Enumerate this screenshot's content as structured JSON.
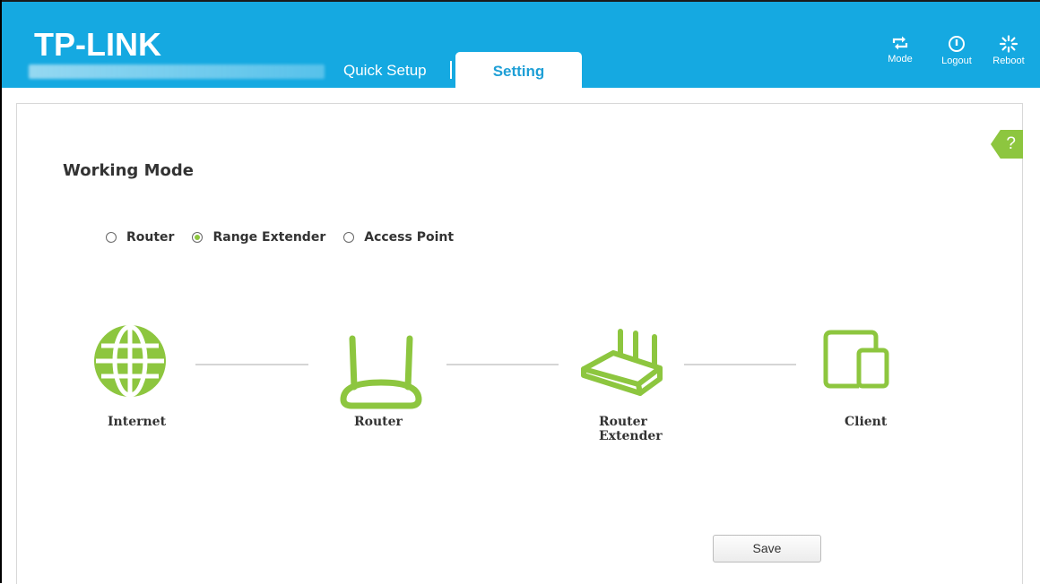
{
  "header": {
    "logo": "TP-LINK",
    "tabs": {
      "quick_setup": "Quick Setup",
      "setting": "Setting"
    },
    "buttons": {
      "mode": "Mode",
      "logout": "Logout",
      "reboot": "Reboot"
    }
  },
  "help": {
    "label": "?"
  },
  "main": {
    "title": "Working Mode",
    "modes": [
      {
        "label": "Router",
        "selected": false
      },
      {
        "label": "Range Extender",
        "selected": true
      },
      {
        "label": "Access Point",
        "selected": false
      }
    ],
    "diagram": [
      {
        "label": "Internet",
        "icon": "globe-icon"
      },
      {
        "label": "Router",
        "icon": "router-icon"
      },
      {
        "label": "Router Extender",
        "icon": "range-extender-icon"
      },
      {
        "label": "Client",
        "icon": "client-devices-icon"
      }
    ],
    "save_label": "Save"
  },
  "colors": {
    "header_bg": "#15a9e1",
    "accent_green": "#8dc63f",
    "tab_text": "#1e9fd6"
  }
}
